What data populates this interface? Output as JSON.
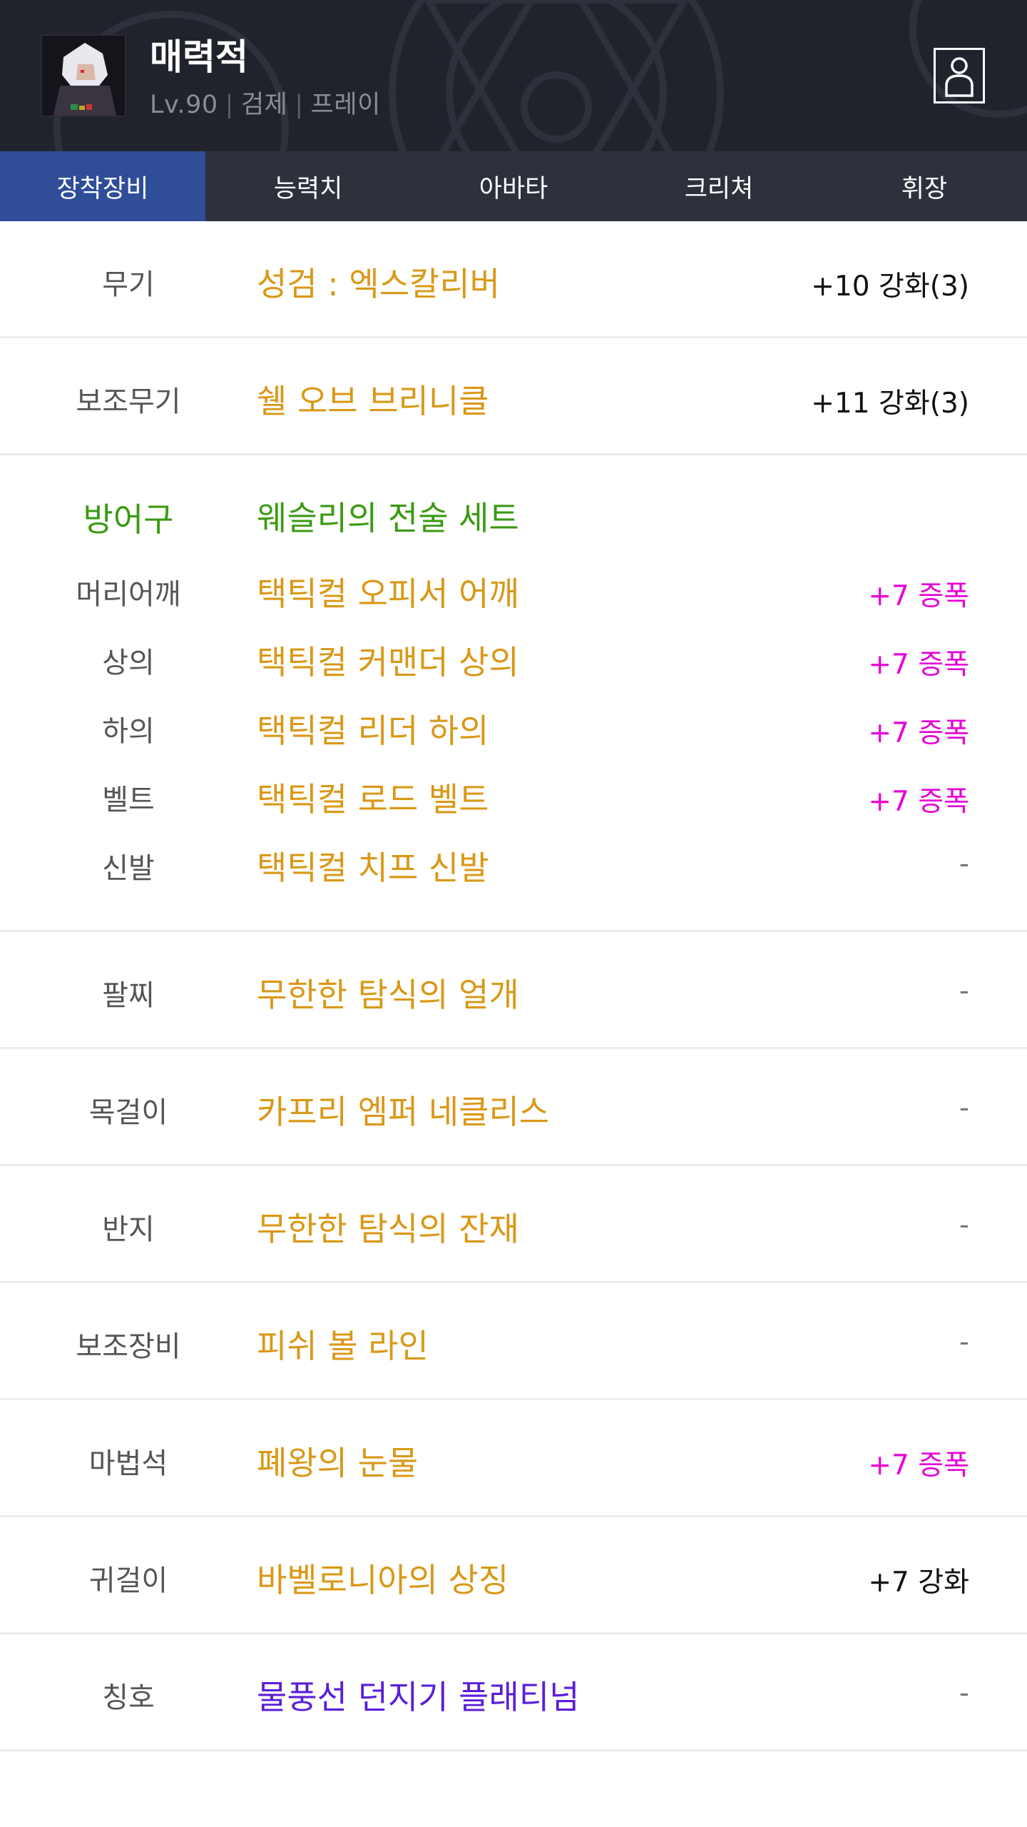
{
  "character": {
    "name": "매력적",
    "level": "Lv.90",
    "server": "검제",
    "job": "프레이",
    "meta_sep": "|"
  },
  "icons": {
    "profile": "person-profile-icon",
    "avatar": "character-portrait"
  },
  "colors": {
    "header_bg": "#20232b",
    "tab_bar_bg": "#2d313b",
    "tab_active": "#2f4d98",
    "item_gold": "#d99817",
    "set_green": "#3a9a12",
    "amp_magenta": "#e600d8",
    "title_purple": "#5a1ed8"
  },
  "tabs": [
    {
      "label": "장착장비",
      "active": true
    },
    {
      "label": "능력치",
      "active": false
    },
    {
      "label": "아바타",
      "active": false
    },
    {
      "label": "크리쳐",
      "active": false
    },
    {
      "label": "휘장",
      "active": false
    }
  ],
  "equipment": {
    "weapon": {
      "slot": "무기",
      "name": "성검 : 엑스칼리버",
      "status": "+10 강화(3)"
    },
    "subweapon": {
      "slot": "보조무기",
      "name": "쉘 오브 브리니클",
      "status": "+11 강화(3)"
    },
    "armor_set": {
      "slot": "방어구",
      "set_name": "웨슬리의 전술 세트",
      "items": [
        {
          "slot": "머리어깨",
          "name": "택틱컬 오피서 어깨",
          "status": "+7 증폭"
        },
        {
          "slot": "상의",
          "name": "택틱컬 커맨더 상의",
          "status": "+7 증폭"
        },
        {
          "slot": "하의",
          "name": "택틱컬 리더 하의",
          "status": "+7 증폭"
        },
        {
          "slot": "벨트",
          "name": "택틱컬 로드 벨트",
          "status": "+7 증폭"
        },
        {
          "slot": "신발",
          "name": "택틱컬 치프 신발",
          "status": "-"
        }
      ]
    },
    "bracelet": {
      "slot": "팔찌",
      "name": "무한한 탐식의 얼개",
      "status": "-"
    },
    "necklace": {
      "slot": "목걸이",
      "name": "카프리 엠퍼 네클리스",
      "status": "-"
    },
    "ring": {
      "slot": "반지",
      "name": "무한한 탐식의 잔재",
      "status": "-"
    },
    "support": {
      "slot": "보조장비",
      "name": "피쉬 볼 라인",
      "status": "-"
    },
    "magicstone": {
      "slot": "마법석",
      "name": "폐왕의 눈물",
      "status": "+7 증폭"
    },
    "earring": {
      "slot": "귀걸이",
      "name": "바벨로니아의 상징",
      "status": "+7 강화"
    },
    "title": {
      "slot": "칭호",
      "name": "물풍선 던지기 플래티넘",
      "status": "-"
    }
  }
}
